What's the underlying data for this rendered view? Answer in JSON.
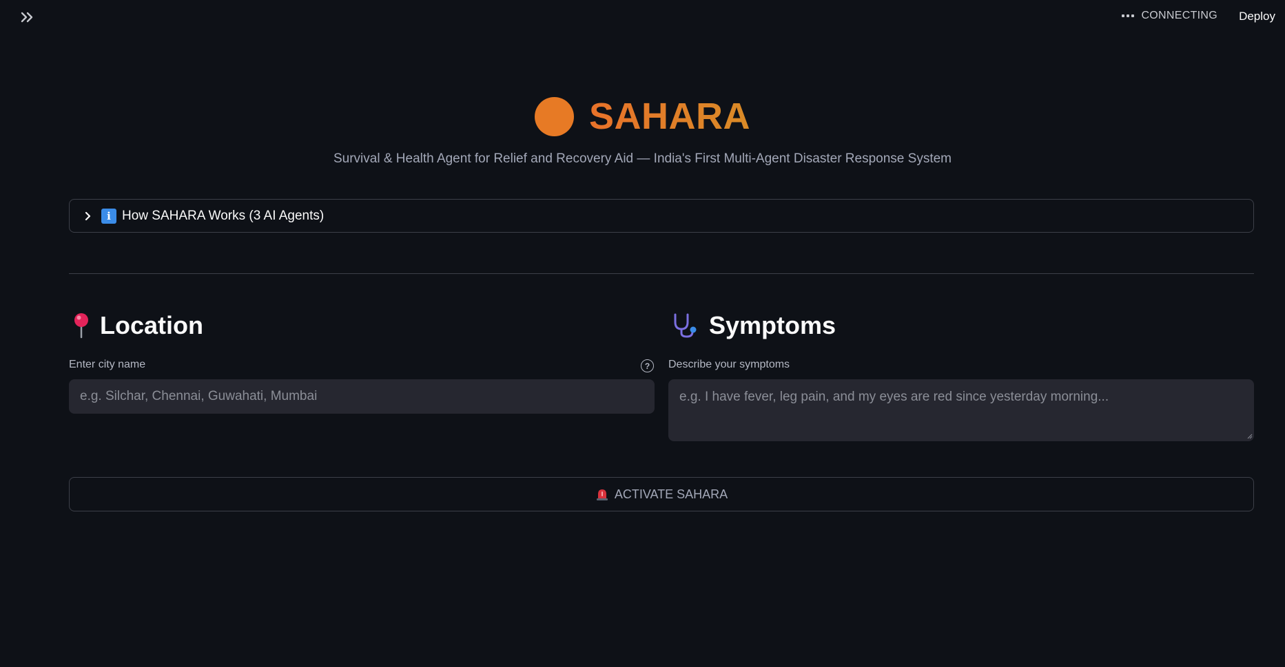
{
  "header": {
    "sidebar_toggle_icon": "chevrons-right-icon",
    "status_text": "CONNECTING",
    "deploy_label": "Deploy"
  },
  "hero": {
    "title": "SAHARA",
    "subtitle": "Survival & Health Agent for Relief and Recovery Aid — India's First Multi-Agent Disaster Response System",
    "accent_color": "#e77a25"
  },
  "expander": {
    "icon": "info-icon",
    "label": "How SAHARA Works (3 AI Agents)"
  },
  "location": {
    "heading": "Location",
    "icon": "pushpin-icon",
    "label": "Enter city name",
    "placeholder": "e.g. Silchar, Chennai, Guwahati, Mumbai",
    "value": ""
  },
  "symptoms": {
    "heading": "Symptoms",
    "icon": "stethoscope-icon",
    "label": "Describe your symptoms",
    "placeholder": "e.g. I have fever, leg pain, and my eyes are red since yesterday morning...",
    "value": ""
  },
  "activate": {
    "icon": "siren-icon",
    "label": "ACTIVATE SAHARA"
  },
  "colors": {
    "background": "#0e1117",
    "input_bg": "#262730",
    "border": "#3d4049"
  }
}
